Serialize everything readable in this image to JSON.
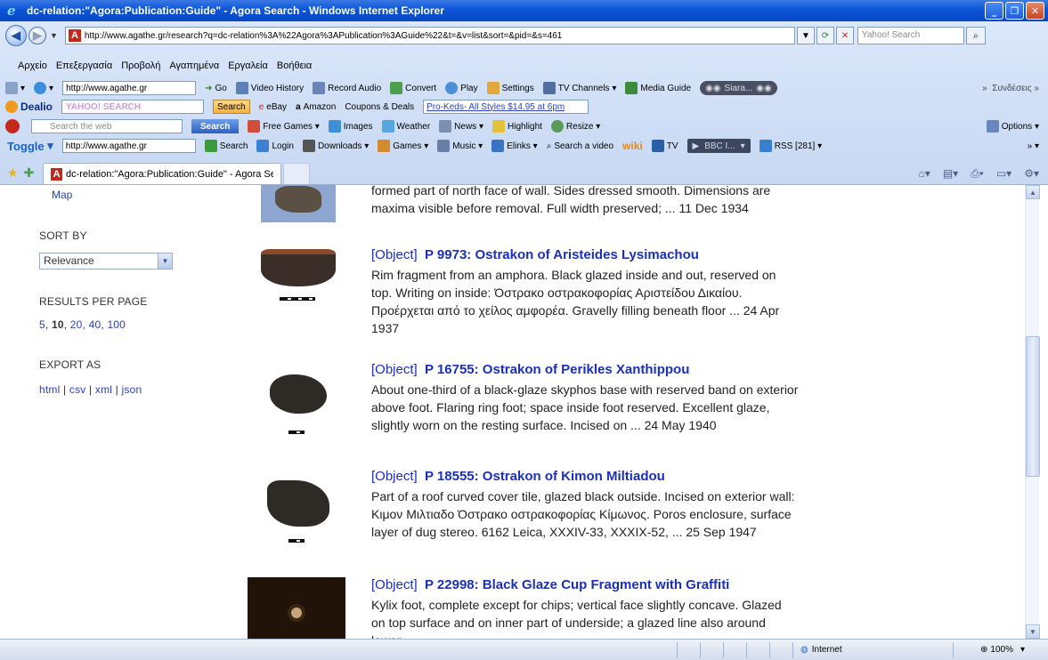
{
  "window": {
    "title": "dc-relation:\"Agora:Publication:Guide\" - Agora Search - Windows Internet Explorer"
  },
  "address_bar": {
    "url": "http://www.agathe.gr/research?q=dc-relation%3A%22Agora%3APublication%3AGuide%22&t=&v=list&sort=&pid=&s=461",
    "search_placeholder": "Yahoo! Search"
  },
  "menu": [
    "Αρχείο",
    "Επεξεργασία",
    "Προβολή",
    "Αγαπημένα",
    "Εργαλεία",
    "Βοήθεια"
  ],
  "toolbar1": {
    "url": "http://www.agathe.gr",
    "go": "Go",
    "items": [
      "Video History",
      "Record Audio",
      "Convert",
      "Play",
      "Settings",
      "TV Channels",
      "Media Guide"
    ],
    "player": "Siara...",
    "links": "Συνδέσεις"
  },
  "toolbar2": {
    "brand": "Dealio",
    "yahoo": "YAHOO! SEARCH",
    "search": "Search",
    "items": [
      "eBay",
      "Amazon",
      "Coupons & Deals"
    ],
    "promo": "Pro-Keds- All Styles $14.95 at 6pm"
  },
  "toolbar3": {
    "placeholder": "Search the web",
    "search": "Search",
    "items": [
      "Free Games",
      "Images",
      "Weather",
      "News",
      "Highlight",
      "Resize"
    ],
    "options": "Options"
  },
  "toolbar4": {
    "brand": "Toggle",
    "url": "http://www.agathe.gr",
    "items": [
      "Search",
      "Login",
      "Downloads",
      "Games",
      "Music",
      "Elinks",
      "Search a video",
      "wiki",
      "TV"
    ],
    "player": "BBC I...",
    "rss": "RSS [281]"
  },
  "tab": {
    "title": "dc-relation:\"Agora:Publication:Guide\" - Agora Search"
  },
  "sidebar": {
    "map_link": "Map",
    "sort_heading": "SORT BY",
    "sort_value": "Relevance",
    "rpp_heading": "RESULTS PER PAGE",
    "rpp_options": [
      "5",
      "10",
      "20",
      "40",
      "100"
    ],
    "export_heading": "EXPORT AS",
    "export_options": [
      "html",
      "csv",
      "xml",
      "json"
    ]
  },
  "results": [
    {
      "snippet_tail": "formed part of north face of wall. Sides dressed smooth. Dimensions are maxima visible before removal. Full width preserved; ... 11 Dec 1934"
    },
    {
      "type": "[Object]",
      "title": "P 9973: Ostrakon of Aristeides Lysimachou",
      "text": "Rim fragment from an amphora. Black glazed inside and out, reserved on top. Writing on inside: Όστρακο οστρακοφορίας Αριστείδου Δικαίου. Προέρχεται από το χείλος αμφορέα. Gravelly filling beneath floor ... 24 Apr 1937"
    },
    {
      "type": "[Object]",
      "title": "P 16755: Ostrakon of Perikles Xanthippou",
      "text": "About one-third of a black-glaze skyphos base with reserved band on exterior above foot. Flaring ring foot; space inside foot reserved. Excellent glaze, slightly worn on the resting surface. Incised on ... 24 May 1940"
    },
    {
      "type": "[Object]",
      "title": "P 18555: Ostrakon of Kimon Miltiadou",
      "text": "Part of a roof curved cover tile, glazed black outside. Incised on exterior wall: Κιμον Μιλτιαδο Όστρακο οστρακοφορίας Κίμωνος. Poros enclosure, surface layer of dug stereo. 6162 Leica, XXXIV-33, XXXIX-52, ... 25 Sep 1947"
    },
    {
      "type": "[Object]",
      "title": "P 22998: Black Glaze Cup Fragment with Graffiti",
      "text": "Kylix foot, complete except for chips; vertical face slightly concave. Glazed on top surface and on inner part of underside; a glazed line also around lower"
    }
  ],
  "status": {
    "zone": "Internet",
    "zoom": "100%"
  }
}
